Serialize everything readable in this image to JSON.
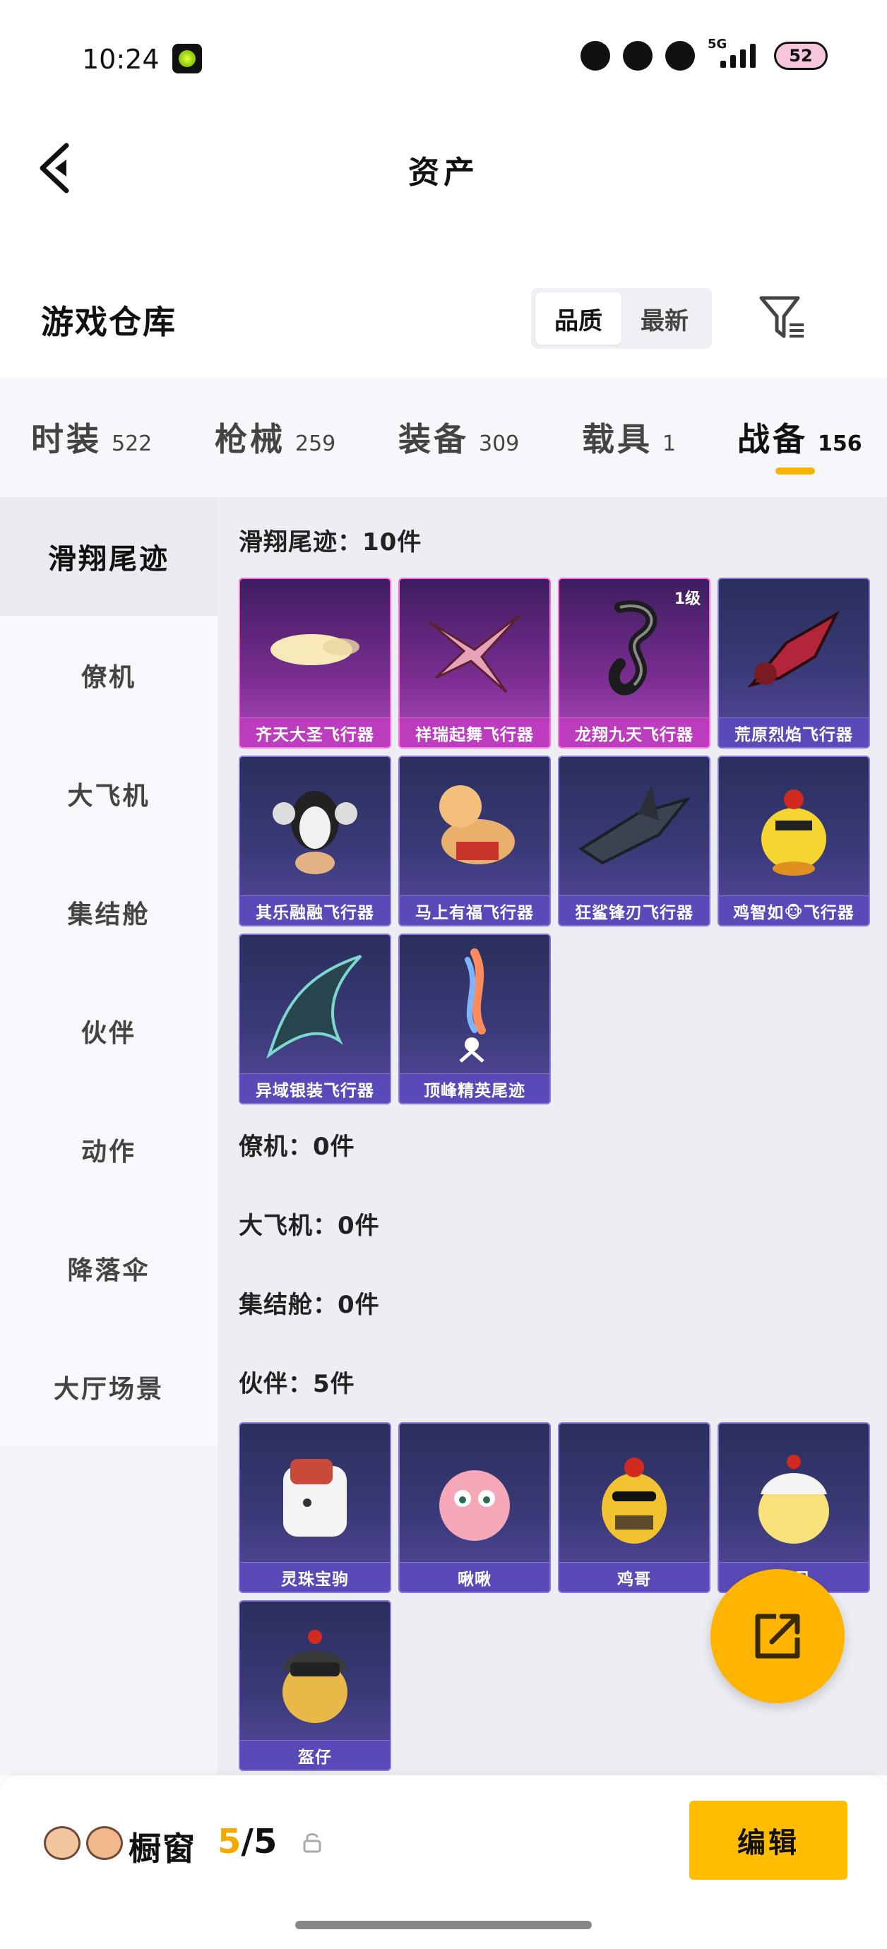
{
  "status_bar": {
    "time": "10:24",
    "network": "5G",
    "battery": "52"
  },
  "nav": {
    "title": "资产"
  },
  "header": {
    "heading": "游戏仓库",
    "sort_options": [
      "品质",
      "最新"
    ],
    "sort_selected": "品质"
  },
  "tabs": [
    {
      "label": "时装",
      "count": "522"
    },
    {
      "label": "枪械",
      "count": "259"
    },
    {
      "label": "装备",
      "count": "309"
    },
    {
      "label": "载具",
      "count": "1"
    },
    {
      "label": "战备",
      "count": "156",
      "active": true
    }
  ],
  "sidebar": {
    "items": [
      {
        "label": "滑翔尾迹",
        "active": true
      },
      {
        "label": "僚机"
      },
      {
        "label": "大飞机"
      },
      {
        "label": "集结舱"
      },
      {
        "label": "伙伴"
      },
      {
        "label": "动作"
      },
      {
        "label": "降落伞"
      },
      {
        "label": "大厅场景"
      }
    ]
  },
  "sections": {
    "glide": {
      "title": "滑翔尾迹：10件",
      "items": [
        {
          "name": "齐天大圣飞行器",
          "rarity": "purple"
        },
        {
          "name": "祥瑞起舞飞行器",
          "rarity": "purple"
        },
        {
          "name": "龙翔九天飞行器",
          "rarity": "purple",
          "level": "1级"
        },
        {
          "name": "荒原烈焰飞行器",
          "rarity": "blue"
        },
        {
          "name": "其乐融融飞行器",
          "rarity": "blue"
        },
        {
          "name": "马上有福飞行器",
          "rarity": "blue"
        },
        {
          "name": "狂鲨锋刃飞行器",
          "rarity": "blue"
        },
        {
          "name": "鸡智如🐵飞行器",
          "rarity": "blue"
        },
        {
          "name": "异域银装飞行器",
          "rarity": "blue"
        },
        {
          "name": "顶峰精英尾迹",
          "rarity": "blue"
        }
      ]
    },
    "wingman": {
      "title": "僚机：0件"
    },
    "big_plane": {
      "title": "大飞机：0件"
    },
    "assembly": {
      "title": "集结舱：0件"
    },
    "partners": {
      "title": "伙伴：5件",
      "items": [
        {
          "name": "灵珠宝驹",
          "rarity": "blue"
        },
        {
          "name": "啾啾",
          "rarity": "blue"
        },
        {
          "name": "鸡哥",
          "rarity": "blue"
        },
        {
          "name": "呆呆",
          "rarity": "blue"
        },
        {
          "name": "盔仔",
          "rarity": "blue"
        }
      ]
    }
  },
  "bottom_bar": {
    "label": "橱窗",
    "count_current": "5",
    "count_total": "/5",
    "edit_label": "编辑"
  },
  "colors": {
    "accent": "#ffbd00",
    "purple_card": "#b04bbd",
    "blue_card": "#574a9e"
  }
}
